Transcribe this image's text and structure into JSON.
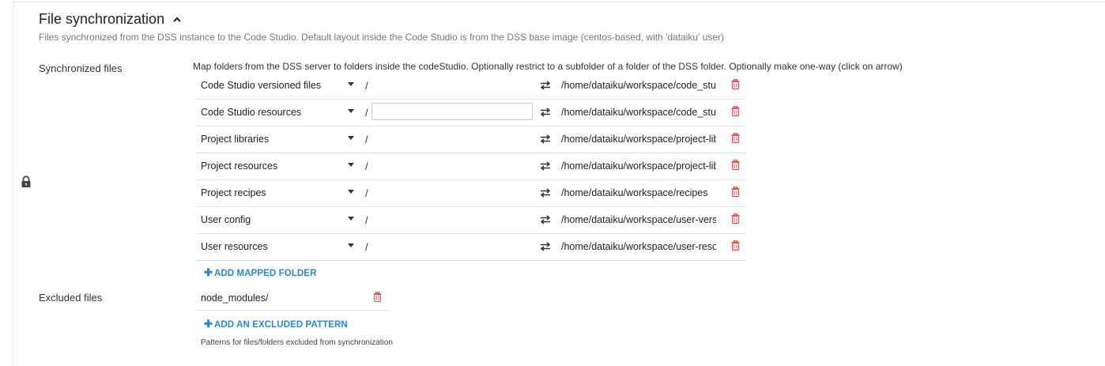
{
  "section": {
    "title": "File synchronization",
    "subtitle": "Files synchronized from the DSS instance to the Code Studio. Default layout inside the Code Studio is from the DSS base image (centos-based, with 'dataiku' user)"
  },
  "sync": {
    "label": "Synchronized files",
    "description": "Map folders from the DSS server to folders inside the codeStudio. Optionally restrict to a subfolder of a folder of the DSS folder. Optionally make one-way (click on arrow)",
    "rows": [
      {
        "folder": "Code Studio versioned files",
        "subfolder": "/",
        "dest": "/home/dataiku/workspace/code_studio-versioned"
      },
      {
        "folder": "Code Studio resources",
        "subfolder": "/",
        "dest": "/home/dataiku/workspace/code_studio-resources"
      },
      {
        "folder": "Project libraries",
        "subfolder": "/",
        "dest": "/home/dataiku/workspace/project-lib-versioned"
      },
      {
        "folder": "Project resources",
        "subfolder": "/",
        "dest": "/home/dataiku/workspace/project-lib-resources"
      },
      {
        "folder": "Project recipes",
        "subfolder": "/",
        "dest": "/home/dataiku/workspace/recipes"
      },
      {
        "folder": "User config",
        "subfolder": "/",
        "dest": "/home/dataiku/workspace/user-versioned"
      },
      {
        "folder": "User resources",
        "subfolder": "/",
        "dest": "/home/dataiku/workspace/user-resources"
      }
    ],
    "add_label": "ADD MAPPED FOLDER"
  },
  "excluded": {
    "label": "Excluded files",
    "patterns": [
      "node_modules/"
    ],
    "add_label": "ADD AN EXCLUDED PATTERN",
    "help": "Patterns for files/folders excluded from synchronization"
  },
  "icons": {
    "lock": "lock-icon",
    "collapse": "chevron-up-icon",
    "dropdown": "caret-down-icon",
    "direction": "bidirectional-arrows-icon",
    "delete": "trash-icon",
    "add": "plus-icon"
  },
  "colors": {
    "accent": "#2b87d8",
    "delete": "#d9534f",
    "muted_text": "#777777"
  }
}
